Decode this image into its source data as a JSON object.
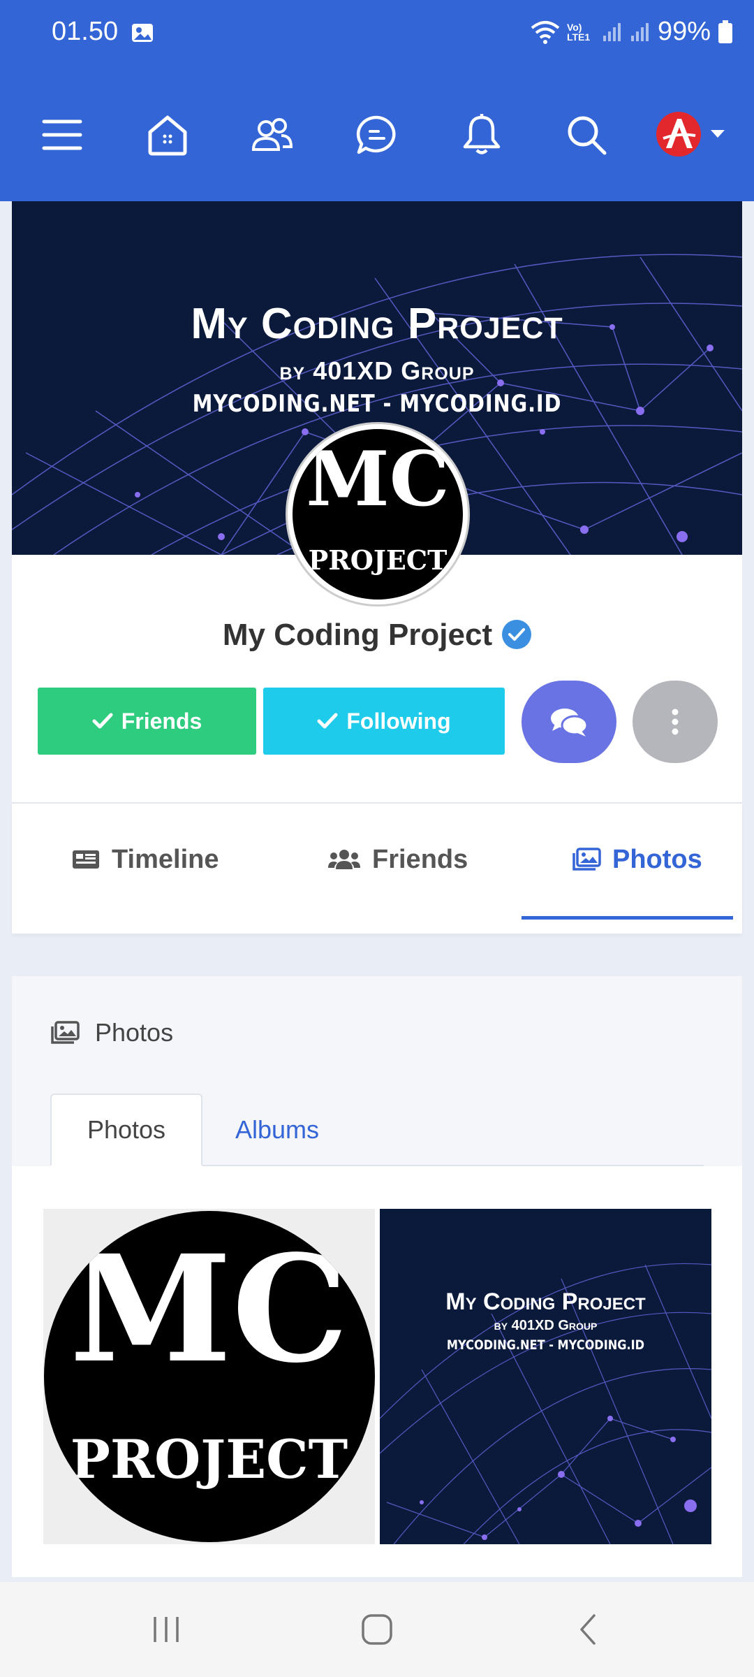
{
  "status": {
    "time": "01.50",
    "network_label": "Vo) LTE1",
    "battery": "99%"
  },
  "nav": {
    "icons": [
      "menu-icon",
      "home-icon",
      "users-icon",
      "chat-icon",
      "bell-icon",
      "search-icon"
    ],
    "avatar_letter": "A"
  },
  "profile": {
    "cover_title": "My Coding Project",
    "cover_subtitle": "by 401XD Group",
    "cover_urls": "MYCODING.NET - MYCODING.ID",
    "avatar_main": "MC",
    "avatar_sub": "PROJECT",
    "name": "My Coding Project",
    "friends_button": "Friends",
    "following_button": "Following"
  },
  "tabs": {
    "timeline": "Timeline",
    "friends": "Friends",
    "photos": "Photos",
    "active": "photos"
  },
  "photos_section": {
    "heading": "Photos",
    "subtab_photos": "Photos",
    "subtab_albums": "Albums",
    "photo1": {
      "main": "MC",
      "sub": "PROJECT"
    },
    "photo2": {
      "title": "My Coding Project",
      "subtitle": "by 401XD Group",
      "urls": "MYCODING.NET - MYCODING.ID"
    }
  },
  "colors": {
    "primary": "#3365d6",
    "friends": "#2ecc7f",
    "following": "#1fcbea",
    "message": "#6a73e3",
    "more": "#b4b6bb",
    "cover": "#0b1a3b"
  }
}
